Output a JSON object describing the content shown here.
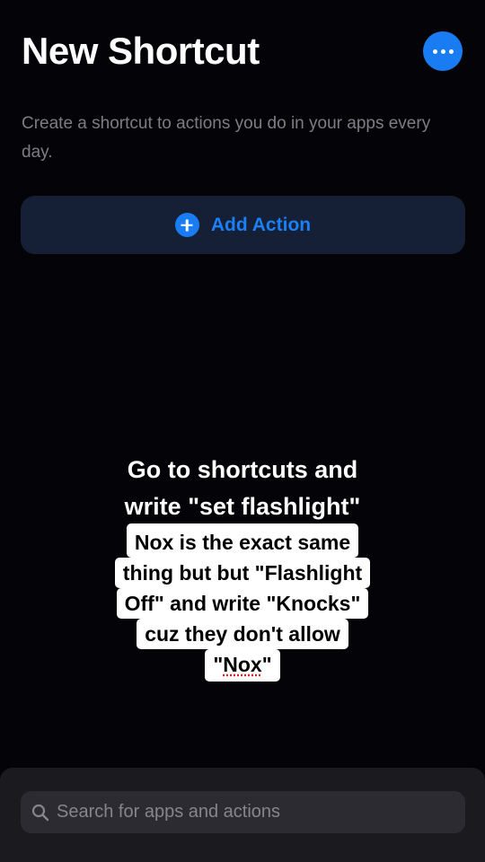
{
  "header": {
    "title": "New Shortcut",
    "more_icon": "ellipsis-icon"
  },
  "main": {
    "description": "Create a shortcut to actions you do in your apps every day.",
    "add_action": {
      "icon": "plus-circle-icon",
      "label": "Add Action"
    }
  },
  "overlay_captions": {
    "caption1_lines": [
      "Go to shortcuts and",
      "write \"set flashlight\""
    ],
    "caption2_lines": [
      "Nox is the exact same",
      "thing but but \"Flashlight",
      "Off\" and write \"Knocks\"",
      "cuz they don't allow"
    ],
    "caption2_last_open": "\"",
    "caption2_last_word": "Nox",
    "caption2_last_close": "\""
  },
  "search": {
    "icon": "search-icon",
    "placeholder": "Search for apps and actions",
    "value": ""
  },
  "colors": {
    "background": "#040307",
    "accent": "#1a7cf2",
    "add_action_bg": "#152036",
    "sheet_bg": "#1b1a1f",
    "search_bg": "#2c2b31"
  }
}
